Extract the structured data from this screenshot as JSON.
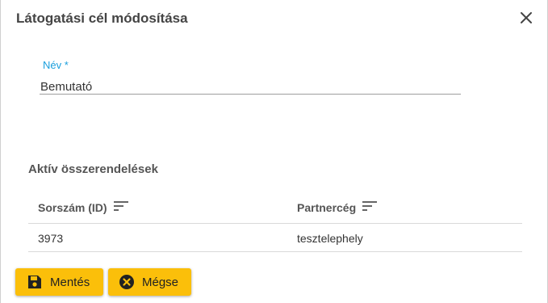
{
  "dialog": {
    "title": "Látogatási cél módosítása"
  },
  "form": {
    "name_label": "Név *",
    "name_value": "Bemutató"
  },
  "assignments": {
    "title": "Aktív összerendelések",
    "columns": [
      "Sorszám (ID)",
      "Partnercég"
    ],
    "rows": [
      {
        "id": "3973",
        "partner": "tesztelephely"
      }
    ]
  },
  "buttons": {
    "save_label": "Mentés",
    "cancel_label": "Mégse"
  },
  "colors": {
    "accent": "#1a9fdd",
    "button": "#fbbf0a"
  },
  "icons": {
    "close": "close-icon",
    "sort": "sort-icon",
    "save": "save-icon",
    "cancel": "cancel-circle-icon"
  }
}
